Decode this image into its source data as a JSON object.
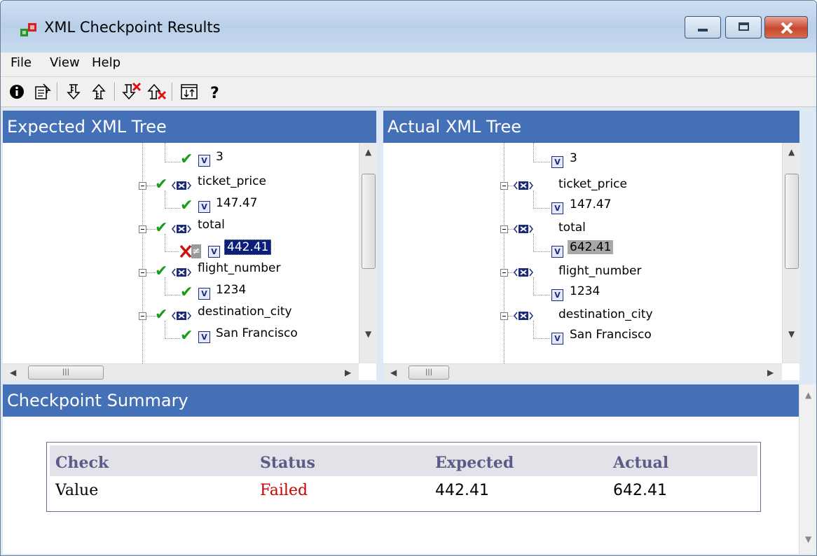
{
  "window": {
    "title": "XML Checkpoint Results"
  },
  "menu": [
    "File",
    "View",
    "Help"
  ],
  "toolbar": [
    {
      "icon": "info-icon"
    },
    {
      "icon": "properties-icon"
    },
    {
      "icon": "next-checkpoint-icon"
    },
    {
      "icon": "previous-checkpoint-icon"
    },
    {
      "icon": "next-failed-icon"
    },
    {
      "icon": "previous-failed-icon"
    },
    {
      "icon": "sync-trees-icon"
    },
    {
      "icon": "help-icon"
    }
  ],
  "expected": {
    "title": "Expected XML Tree",
    "rows": [
      {
        "type": "value",
        "text": "3",
        "status": "ok"
      },
      {
        "type": "element",
        "text": "ticket_price",
        "status": "ok"
      },
      {
        "type": "value",
        "text": "147.47",
        "status": "ok"
      },
      {
        "type": "element",
        "text": "total",
        "status": "ok"
      },
      {
        "type": "value",
        "text": "442.41",
        "status": "failed"
      },
      {
        "type": "element",
        "text": "flight_number",
        "status": "ok"
      },
      {
        "type": "value",
        "text": "1234",
        "status": "ok"
      },
      {
        "type": "element",
        "text": "destination_city",
        "status": "ok"
      },
      {
        "type": "value",
        "text": "San Francisco",
        "status": "ok"
      }
    ]
  },
  "actual": {
    "title": "Actual XML Tree",
    "rows": [
      {
        "type": "value",
        "text": "3"
      },
      {
        "type": "element",
        "text": "ticket_price"
      },
      {
        "type": "value",
        "text": "147.47"
      },
      {
        "type": "element",
        "text": "total"
      },
      {
        "type": "value",
        "text": "642.41"
      },
      {
        "type": "element",
        "text": "flight_number"
      },
      {
        "type": "value",
        "text": "1234"
      },
      {
        "type": "element",
        "text": "destination_city"
      },
      {
        "type": "value",
        "text": "San Francisco"
      }
    ]
  },
  "summary": {
    "title": "Checkpoint Summary",
    "headers": {
      "check": "Check",
      "status": "Status",
      "expected": "Expected",
      "actual": "Actual"
    },
    "row": {
      "check": "Value",
      "status": "Failed",
      "expected": "442.41",
      "actual": "642.41"
    }
  },
  "colors": {
    "header_blue": "#4470b8",
    "failed_red": "#cc0000",
    "check_green": "#1a9c1a",
    "selection_blue": "#0a1e7a"
  }
}
